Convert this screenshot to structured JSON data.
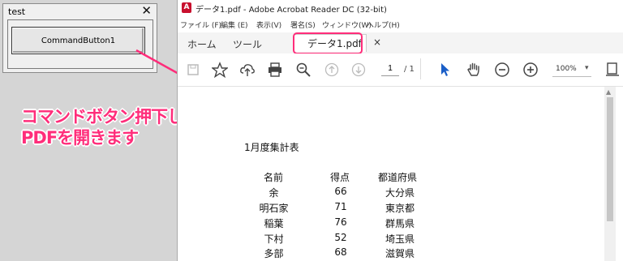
{
  "userform": {
    "title": "test",
    "close_glyph": "✕",
    "command_button_label": "CommandButton1"
  },
  "annotation": {
    "line1": "コマンドボタン押下して",
    "line2": "PDFを開きます",
    "color": "#ff2d7a"
  },
  "acrobat": {
    "window_title": "データ1.pdf - Adobe Acrobat Reader DC (32-bit)",
    "menu": [
      "ファイル (F)",
      "編集 (E)",
      "表示(V)",
      "署名(S)",
      "ウィンドウ(W)",
      "ヘルプ(H)"
    ],
    "tabs": {
      "home": "ホーム",
      "tools": "ツール",
      "document": "データ1.pdf",
      "close_glyph": "×"
    },
    "toolbar": {
      "page_current": "1",
      "page_total": "/ 1",
      "zoom": "100%",
      "icons": [
        "save-icon",
        "bookmark-star-icon",
        "upload-icon",
        "print-icon",
        "zoom-search-icon",
        "prev-page-icon",
        "next-page-icon",
        "select-cursor-icon",
        "hand-icon",
        "zoom-out-icon",
        "zoom-in-icon",
        "page-fit-icon"
      ]
    },
    "document": {
      "title": "1月度集計表",
      "headers": [
        "名前",
        "得点",
        "都道府県"
      ],
      "rows": [
        [
          "余",
          "66",
          "大分県"
        ],
        [
          "明石家",
          "71",
          "東京都"
        ],
        [
          "稲葉",
          "76",
          "群馬県"
        ],
        [
          "下村",
          "52",
          "埼玉県"
        ],
        [
          "多部",
          "68",
          "滋賀県"
        ]
      ]
    }
  }
}
